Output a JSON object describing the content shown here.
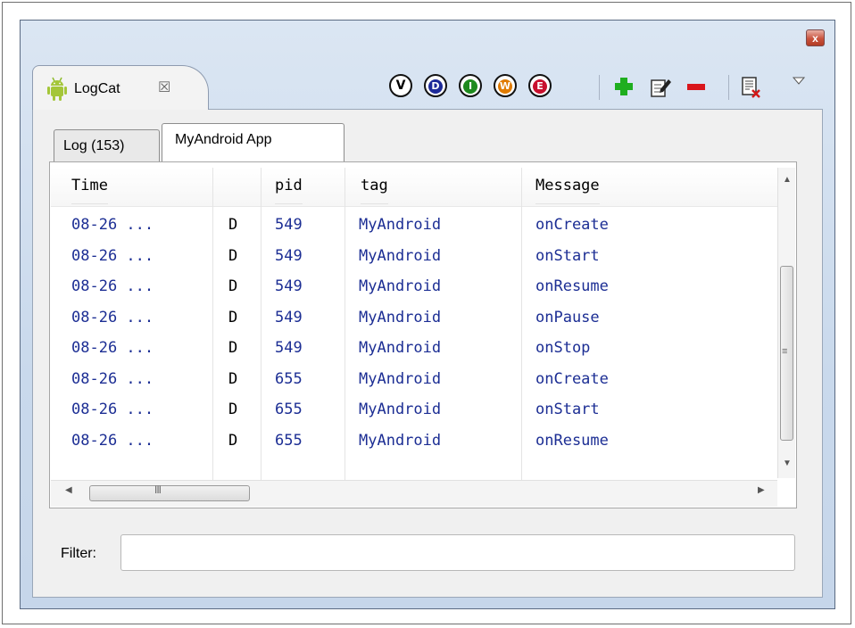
{
  "window": {
    "close_symbol": "x"
  },
  "view_tab": {
    "title": "LogCat",
    "icon": "android-icon",
    "close_symbol": "☒"
  },
  "toolbar": {
    "buttons": [
      {
        "name": "verbose-filter-button",
        "letter": "V",
        "color": "#000000"
      },
      {
        "name": "debug-filter-button",
        "letter": "D",
        "color": "#1d2a99"
      },
      {
        "name": "info-filter-button",
        "letter": "I",
        "color": "#1e8a1e"
      },
      {
        "name": "warning-filter-button",
        "letter": "W",
        "color": "#e07b00"
      },
      {
        "name": "error-filter-button",
        "letter": "E",
        "color": "#c8102e"
      }
    ],
    "add_icon": "plus-icon",
    "edit_icon": "edit-icon",
    "remove_icon": "minus-icon",
    "clear_icon": "clear-log-icon",
    "menu_icon": "view-menu-icon"
  },
  "tabs": [
    {
      "label": "Log (153)",
      "selected": false
    },
    {
      "label": "MyAndroid App",
      "selected": true
    }
  ],
  "table": {
    "columns": [
      "Time",
      "",
      "pid",
      "tag",
      "Message"
    ],
    "rows": [
      {
        "time": "08-26 ...",
        "level": "D",
        "pid": "549",
        "tag": "MyAndroid",
        "message": "onCreate"
      },
      {
        "time": "08-26 ...",
        "level": "D",
        "pid": "549",
        "tag": "MyAndroid",
        "message": "onStart"
      },
      {
        "time": "08-26 ...",
        "level": "D",
        "pid": "549",
        "tag": "MyAndroid",
        "message": "onResume"
      },
      {
        "time": "08-26 ...",
        "level": "D",
        "pid": "549",
        "tag": "MyAndroid",
        "message": "onPause"
      },
      {
        "time": "08-26 ...",
        "level": "D",
        "pid": "549",
        "tag": "MyAndroid",
        "message": "onStop"
      },
      {
        "time": "08-26 ...",
        "level": "D",
        "pid": "655",
        "tag": "MyAndroid",
        "message": "onCreate"
      },
      {
        "time": "08-26 ...",
        "level": "D",
        "pid": "655",
        "tag": "MyAndroid",
        "message": "onStart"
      },
      {
        "time": "08-26 ...",
        "level": "D",
        "pid": "655",
        "tag": "MyAndroid",
        "message": "onResume"
      }
    ]
  },
  "filter": {
    "label": "Filter:",
    "value": "",
    "placeholder": ""
  },
  "colors": {
    "log_text": "#1c2e94",
    "accent_window": "#c9d9ec"
  }
}
